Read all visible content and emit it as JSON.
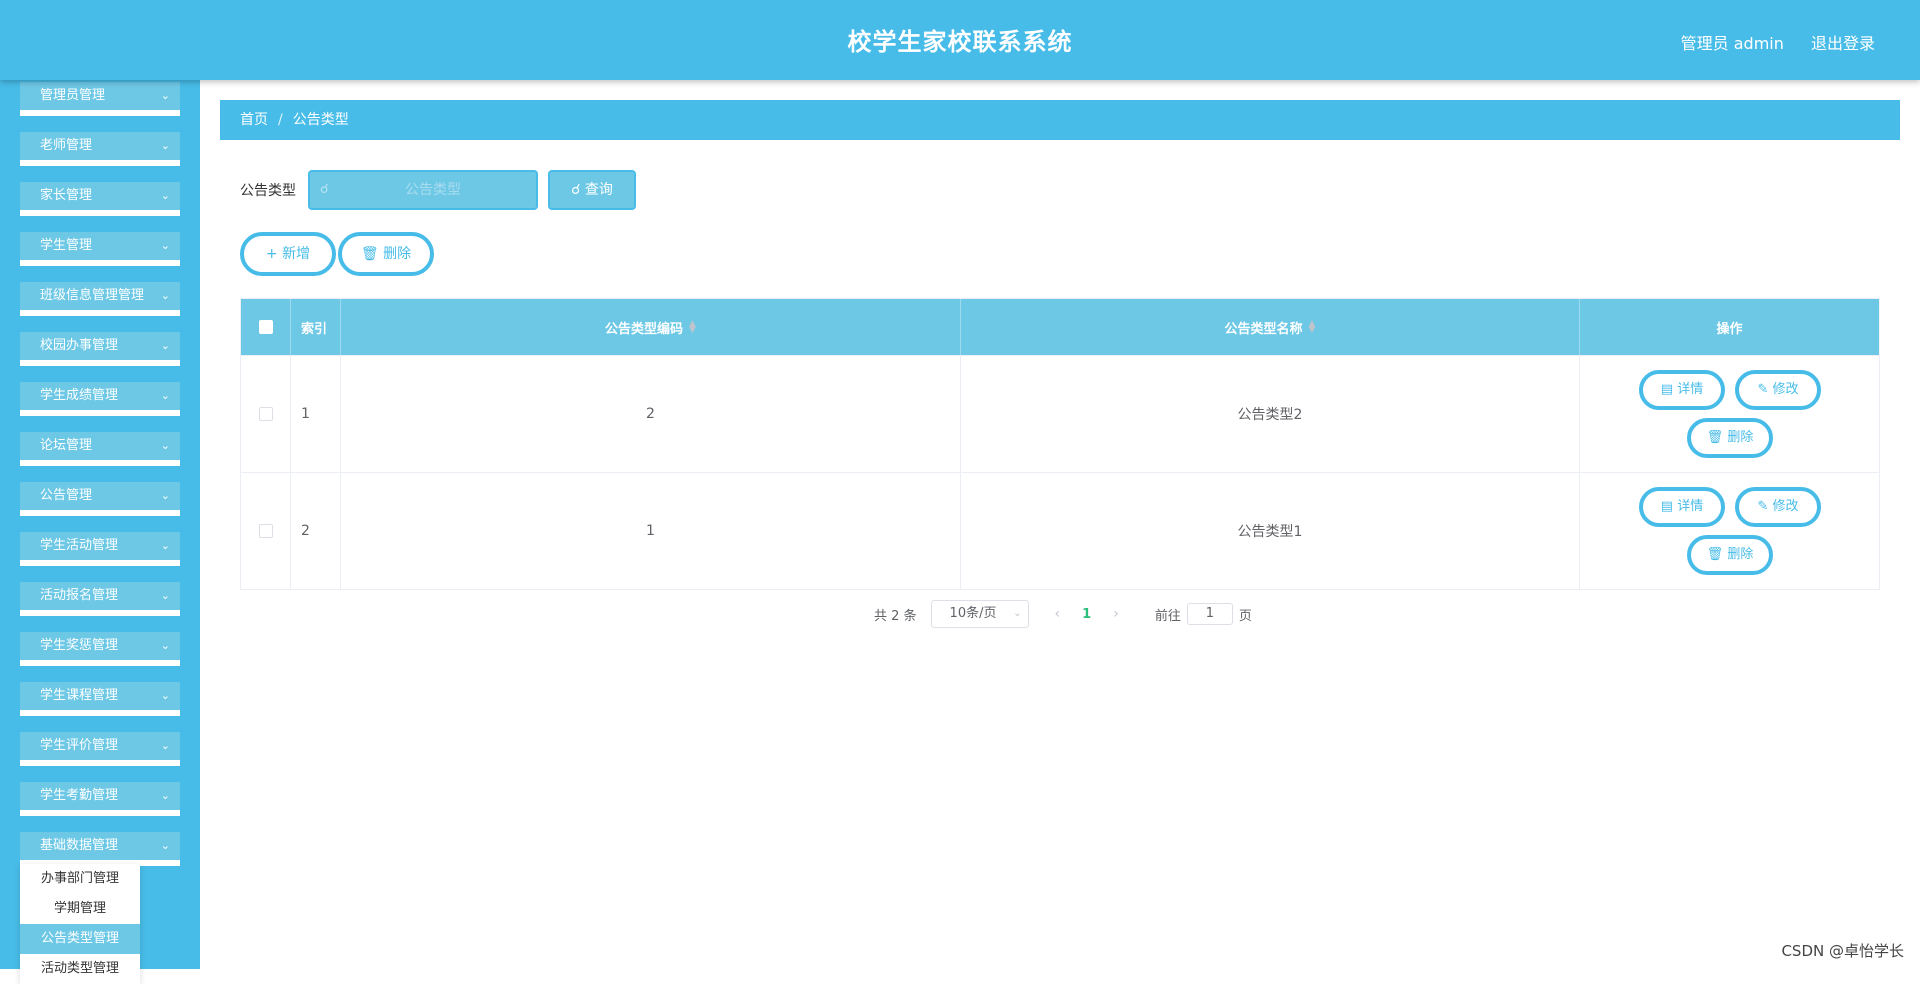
{
  "header": {
    "title": "校学生家校联系系统",
    "user_label": "管理员 admin",
    "logout_label": "退出登录"
  },
  "sidebar": {
    "items": [
      {
        "label": "管理员管理"
      },
      {
        "label": "老师管理"
      },
      {
        "label": "家长管理"
      },
      {
        "label": "学生管理"
      },
      {
        "label": "班级信息管理管理"
      },
      {
        "label": "校园办事管理"
      },
      {
        "label": "学生成绩管理"
      },
      {
        "label": "论坛管理"
      },
      {
        "label": "公告管理"
      },
      {
        "label": "学生活动管理"
      },
      {
        "label": "活动报名管理"
      },
      {
        "label": "学生奖惩管理"
      },
      {
        "label": "学生课程管理"
      },
      {
        "label": "学生评价管理"
      },
      {
        "label": "学生考勤管理"
      },
      {
        "label": "基础数据管理"
      }
    ],
    "submenu": [
      {
        "label": "办事部门管理"
      },
      {
        "label": "学期管理"
      },
      {
        "label": "公告类型管理"
      },
      {
        "label": "活动类型管理"
      }
    ]
  },
  "breadcrumb": {
    "home": "首页",
    "separator": "/",
    "current": "公告类型"
  },
  "filter": {
    "label": "公告类型",
    "placeholder": "公告类型",
    "query_label": "查询"
  },
  "actions": {
    "add_label": "新增",
    "delete_label": "删除"
  },
  "table": {
    "columns": {
      "index": "索引",
      "code": "公告类型编码",
      "name": "公告类型名称",
      "ops": "操作"
    },
    "rows": [
      {
        "index": "1",
        "code": "2",
        "name": "公告类型2"
      },
      {
        "index": "2",
        "code": "1",
        "name": "公告类型1"
      }
    ],
    "op_labels": {
      "detail": "详情",
      "edit": "修改",
      "delete": "删除"
    }
  },
  "pagination": {
    "total": "共 2 条",
    "page_size": "10条/页",
    "current_page": "1",
    "goto_label": "前往",
    "goto_value": "1",
    "page_suffix": "页"
  },
  "watermark": "CSDN @卓怡学长",
  "colors": {
    "primary": "#47bce8",
    "light": "#6dc8e6",
    "current_page": "#2bbd7d"
  }
}
